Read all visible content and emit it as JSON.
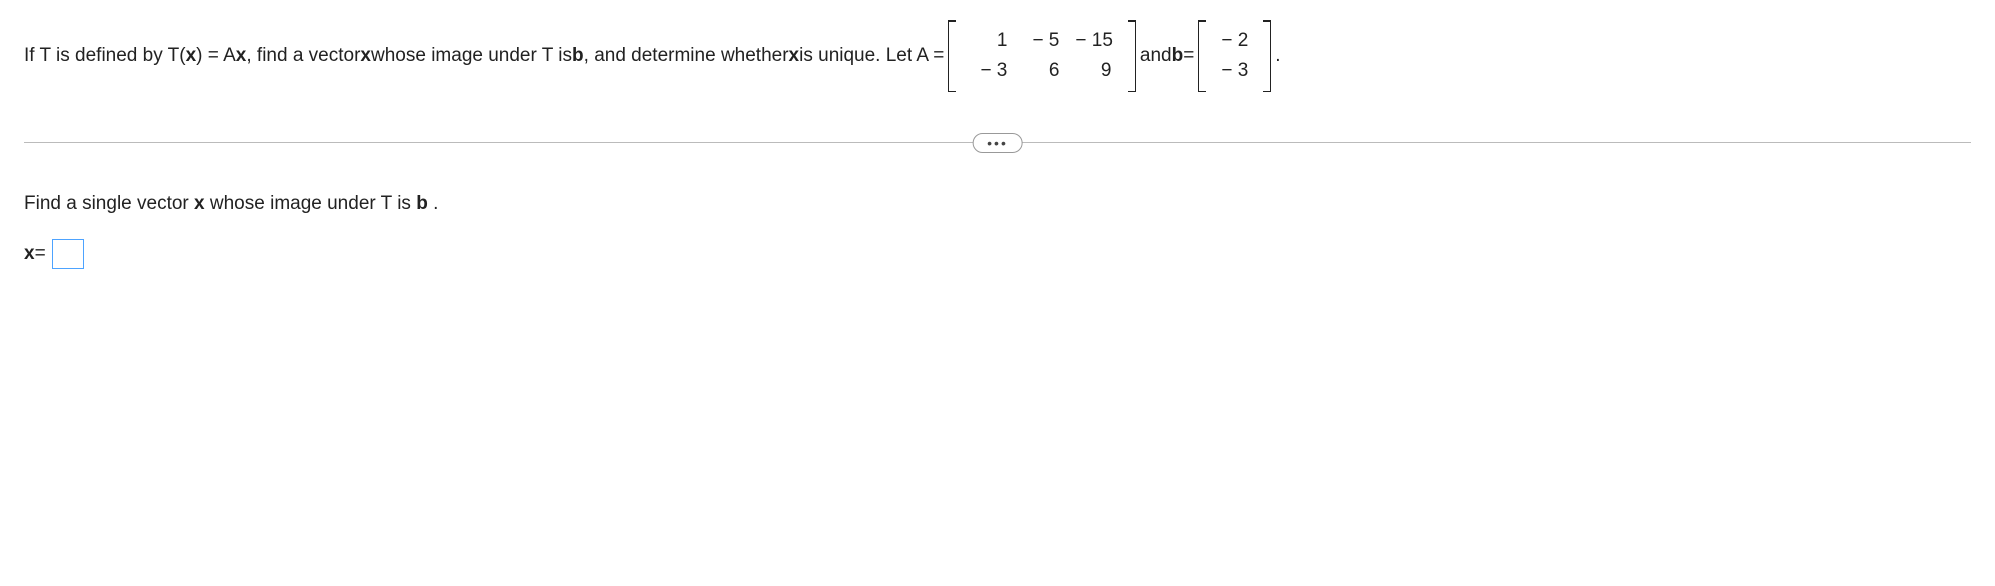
{
  "problem": {
    "prefix": "If T is defined by T(",
    "x1": "x",
    "mid1": ") = A",
    "x2": "x",
    "mid2": ", find a vector ",
    "x3": "x",
    "mid3": " whose image under T is ",
    "b1": "b",
    "mid4": ", and determine whether ",
    "x4": "x",
    "mid5": " is unique. Let A = ",
    "and": " and ",
    "b2": "b",
    "eq": " = ",
    "period": "."
  },
  "matrixA": {
    "r0c0": "1",
    "r0c1": "− 5",
    "r0c2": "− 15",
    "r1c0": "− 3",
    "r1c1": "6",
    "r1c2": "9"
  },
  "matrixB": {
    "r0": "− 2",
    "r1": "− 3"
  },
  "ellipsis": "•••",
  "answer": {
    "prompt_pre": "Find a single vector ",
    "prompt_x": "x",
    "prompt_mid": " whose image under T is ",
    "prompt_b": "b",
    "prompt_end": ".",
    "label_x": "x",
    "label_eq": " = "
  }
}
